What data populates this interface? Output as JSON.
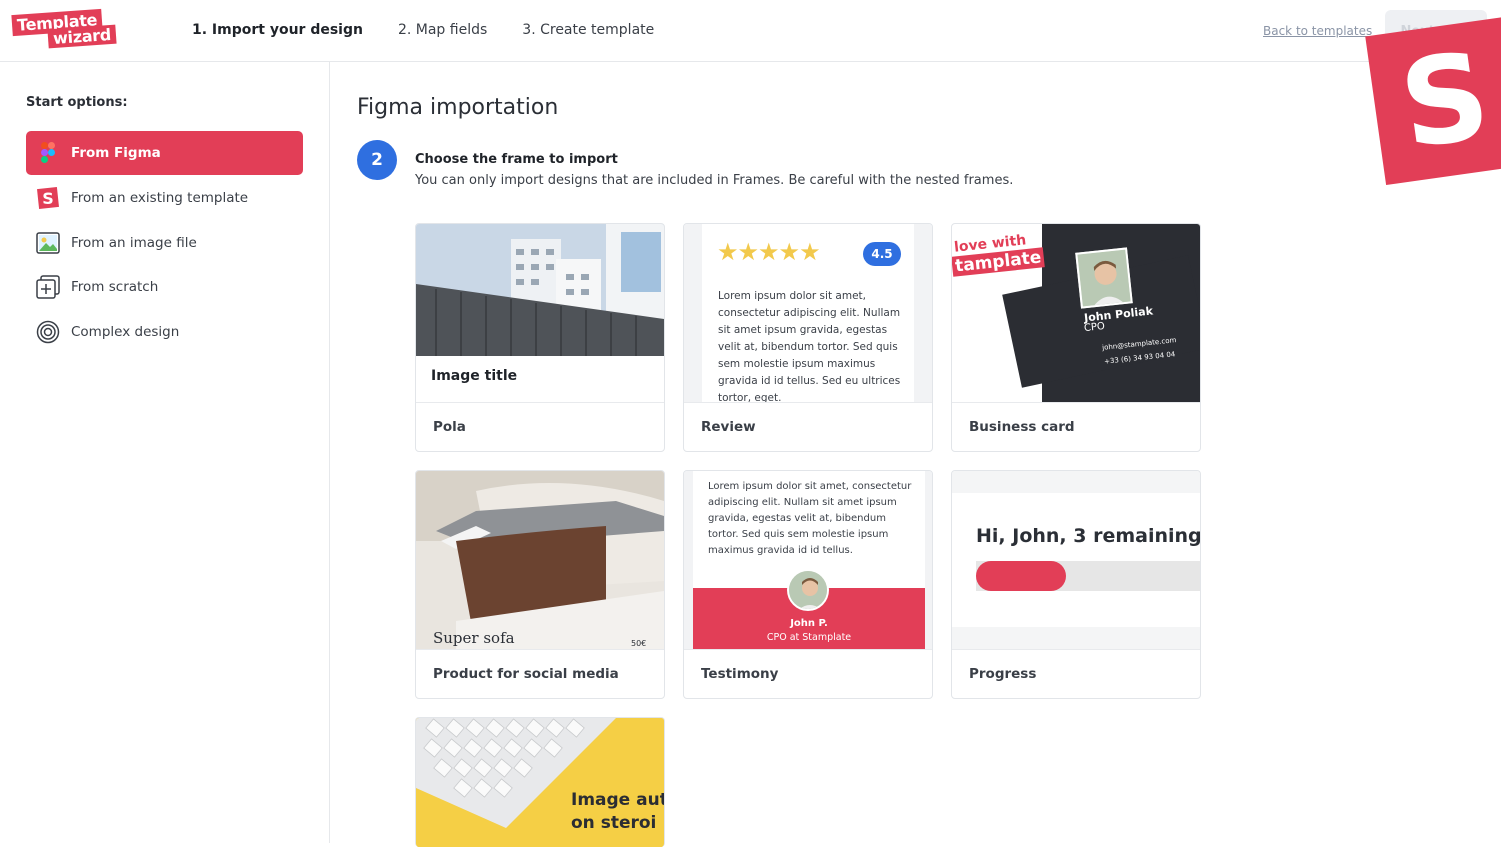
{
  "header": {
    "logo_line1": "Template",
    "logo_line2": "wizard",
    "steps": [
      "1. Import your design",
      "2. Map fields",
      "3. Create template"
    ],
    "back_link": "Back to templates",
    "next_button": "Next step",
    "brand_badge": "S"
  },
  "sidebar": {
    "title": "Start options:",
    "items": [
      {
        "label": "From Figma",
        "icon": "figma-icon",
        "active": true
      },
      {
        "label": "From an existing template",
        "icon": "stamplate-icon"
      },
      {
        "label": "From an image file",
        "icon": "image-icon"
      },
      {
        "label": "From scratch",
        "icon": "add-square-icon"
      },
      {
        "label": "Complex design",
        "icon": "spiral-icon"
      }
    ]
  },
  "main": {
    "title": "Figma importation",
    "step_number": "2",
    "step_title": "Choose the frame to import",
    "step_subtitle": "You can only import designs that are included in Frames. Be careful with the nested frames."
  },
  "cards": [
    {
      "label": "Pola",
      "preview": {
        "caption": "Image title"
      }
    },
    {
      "label": "Review",
      "preview": {
        "stars": "★★★★★",
        "rating": "4.5",
        "text": "Lorem ipsum dolor sit amet, consectetur adipiscing elit. Nullam sit amet ipsum gravida, egestas velit at, bibendum tortor. Sed quis sem molestie ipsum maximus gravida id id tellus. Sed eu ultrices tortor, eget."
      }
    },
    {
      "label": "Business card",
      "preview": {
        "tagline1": "love with",
        "tagline2": "tamplate",
        "name": "John Poliak",
        "role": "CPO",
        "email": "john@stamplate.com",
        "phone": "+33 (6) 34 93 04 04"
      }
    },
    {
      "label": "Product for social media",
      "preview": {
        "title": "Super sofa",
        "price": "50€"
      }
    },
    {
      "label": "Testimony",
      "preview": {
        "text": "Lorem ipsum dolor sit amet, consectetur adipiscing elit. Nullam sit amet ipsum gravida, egestas velit at, bibendum tortor. Sed quis sem molestie ipsum maximus gravida id id tellus.",
        "name": "John P.",
        "role": "CPO at Stamplate"
      }
    },
    {
      "label": "Progress",
      "preview": {
        "headline": "Hi, John, 3 remaining",
        "progress": 0.4
      }
    },
    {
      "label": "",
      "preview": {
        "line1": "Image aut",
        "line2": "on steroi"
      }
    }
  ],
  "colors": {
    "accent": "#e23e57",
    "blue": "#2f6fe0",
    "star": "#f2c94c"
  }
}
